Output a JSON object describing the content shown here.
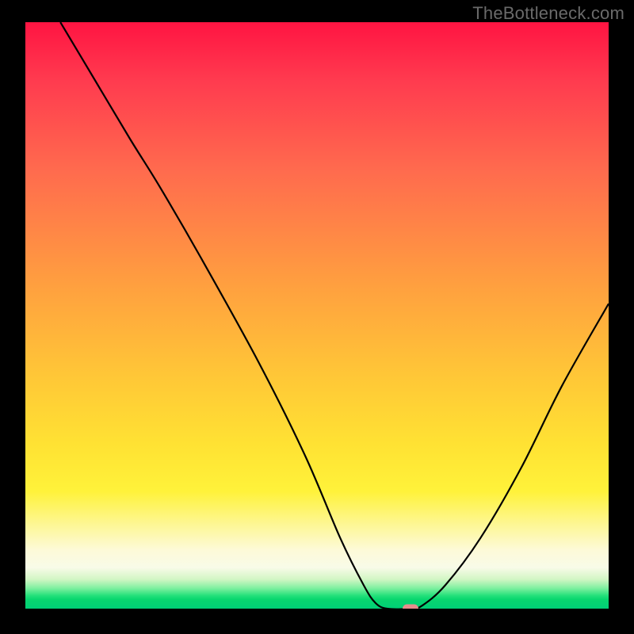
{
  "watermark": "TheBottleneck.com",
  "colors": {
    "frame": "#000000",
    "watermark": "#6a6a6a",
    "curve": "#000000",
    "marker": "#e88d8d"
  },
  "chart_data": {
    "type": "line",
    "title": "",
    "xlabel": "",
    "ylabel": "",
    "xlim": [
      0,
      100
    ],
    "ylim": [
      0,
      100
    ],
    "grid": false,
    "legend": false,
    "curve_points": [
      {
        "x": 6,
        "y": 100
      },
      {
        "x": 12,
        "y": 90
      },
      {
        "x": 18,
        "y": 80
      },
      {
        "x": 23,
        "y": 72
      },
      {
        "x": 30,
        "y": 60
      },
      {
        "x": 40,
        "y": 42
      },
      {
        "x": 48,
        "y": 26
      },
      {
        "x": 54,
        "y": 12
      },
      {
        "x": 58,
        "y": 4
      },
      {
        "x": 60,
        "y": 1
      },
      {
        "x": 62,
        "y": 0
      },
      {
        "x": 66,
        "y": 0
      },
      {
        "x": 68,
        "y": 0.5
      },
      {
        "x": 72,
        "y": 4
      },
      {
        "x": 78,
        "y": 12
      },
      {
        "x": 85,
        "y": 24
      },
      {
        "x": 92,
        "y": 38
      },
      {
        "x": 100,
        "y": 52
      }
    ],
    "marker": {
      "x": 66,
      "y": 0
    },
    "background_gradient": [
      {
        "stop": 0,
        "color": "#ff1442"
      },
      {
        "stop": 0.8,
        "color": "#fff23a"
      },
      {
        "stop": 0.97,
        "color": "#23e07a"
      },
      {
        "stop": 1.0,
        "color": "#00cf76"
      }
    ]
  }
}
